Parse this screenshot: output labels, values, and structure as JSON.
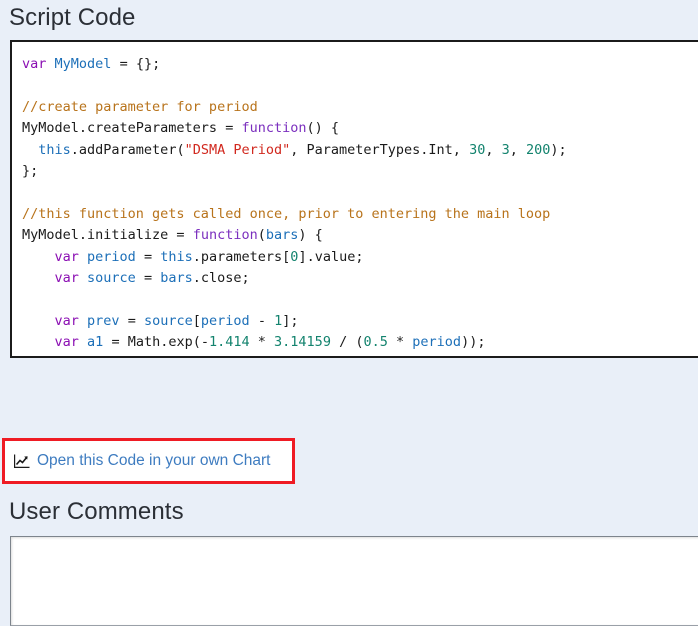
{
  "page": {
    "background_color": "#e9eff8"
  },
  "script_code_section": {
    "heading": "Script Code",
    "code_block": {
      "background_color": "#ffffff",
      "border_color": "#1b1b1b",
      "language": "javascript",
      "colors": {
        "keyword": "#8b0fb3",
        "function": "#7b2fbe",
        "identifier": "#1c6fb8",
        "string": "#d1281e",
        "number": "#13836e",
        "comment": "#b8731b",
        "plain": "#1b1b1b"
      },
      "lines": [
        "var MyModel = {};",
        "",
        "//create parameter for period",
        "MyModel.createParameters = function() {",
        "  this.addParameter(\"DSMA Period\", ParameterTypes.Int, 30, 3, 200);",
        "};",
        "",
        "//this function gets called once, prior to entering the main loop",
        "MyModel.initialize = function(bars) {",
        "    var period = this.parameters[0].value;",
        "    var source = bars.close;",
        "",
        "    var prev = source[period - 1];",
        "    var a1 = Math.exp(-1.414 * 3.14159 / (0.5 * period));"
      ]
    }
  },
  "open_chart_link": {
    "label": "Open this Code in your own Chart",
    "icon": "chart-line-icon",
    "text_color": "#3e7cc0",
    "highlight_border_color": "#ef1b24"
  },
  "user_comments_section": {
    "heading": "User Comments",
    "textarea": {
      "value": "",
      "placeholder": ""
    }
  }
}
